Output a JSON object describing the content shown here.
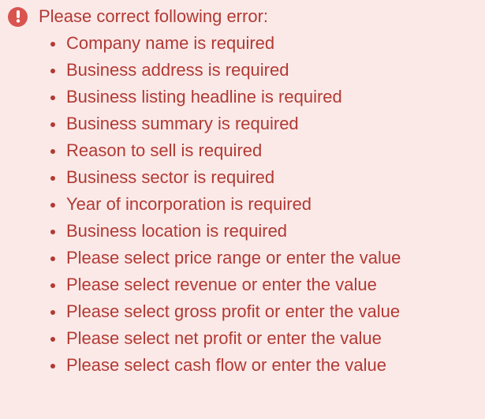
{
  "alert": {
    "icon": "exclamation-circle-icon",
    "heading": "Please correct following error:",
    "colors": {
      "background": "#fbe9e8",
      "text": "#b13a33",
      "icon": "#d9534f"
    },
    "errors": [
      "Company name is required",
      "Business address is required",
      "Business listing headline is required",
      "Business summary is required",
      "Reason to sell is required",
      "Business sector is required",
      "Year of incorporation is required",
      "Business location is required",
      "Please select price range or enter the value",
      "Please select revenue or enter the value",
      "Please select gross profit or enter the value",
      "Please select net profit or enter the value",
      "Please select cash flow or enter the value"
    ]
  }
}
